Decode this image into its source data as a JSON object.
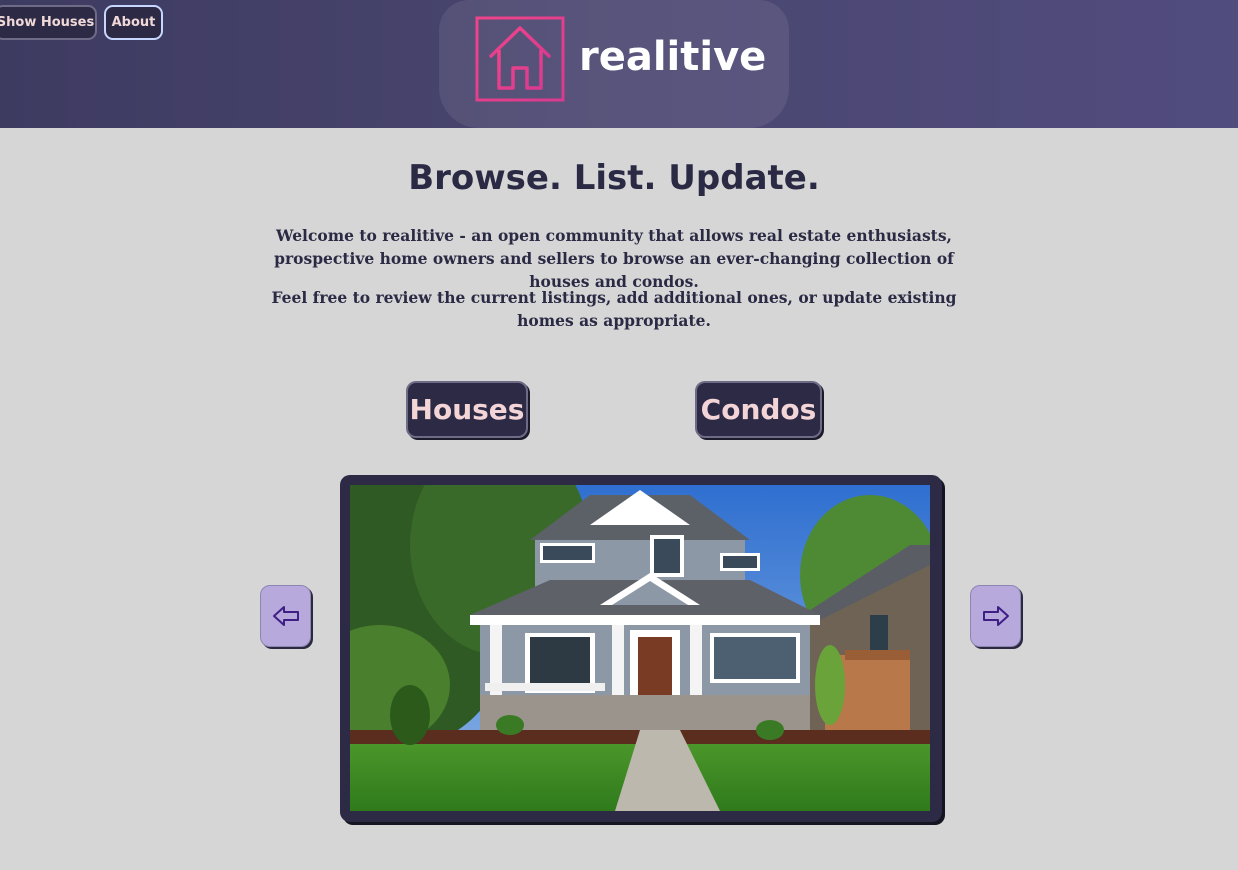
{
  "nav": {
    "show_houses": "Show Houses",
    "about": "About"
  },
  "brand": {
    "name": "realitive",
    "icon": "house-outline-icon",
    "accent": "#e8488e"
  },
  "hero": {
    "headline": "Browse. List. Update.",
    "paragraph_1": "Welcome to realitive - an open community that allows real estate enthusiasts, prospective home owners and sellers to browse an ever-changing collection of houses and condos.",
    "paragraph_2": "Feel free to review the current listings, add additional ones, or update existing homes as appropriate."
  },
  "categories": {
    "houses": "Houses",
    "condos": "Condos"
  },
  "carousel": {
    "prev_icon": "arrow-left-icon",
    "next_icon": "arrow-right-icon",
    "image_subject": "two-story grey craftsman house with front porch"
  },
  "colors": {
    "header_bg": "#48446d",
    "page_bg": "#d6d6d6",
    "button_bg": "#2d2a45",
    "button_text": "#f3d5d8",
    "arrow_bg": "#b7a9dc"
  }
}
